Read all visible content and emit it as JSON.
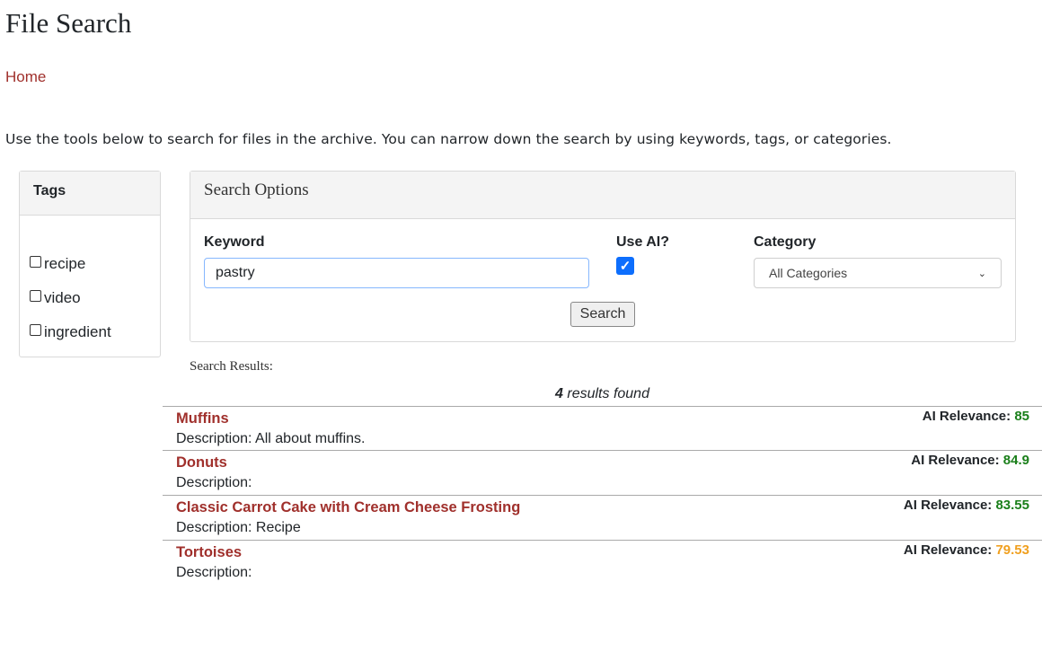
{
  "page": {
    "title": "File Search",
    "home_link": "Home",
    "intro": "Use the tools below to search for files in the archive. You can narrow down the search by using keywords, tags, or categories."
  },
  "tags": {
    "header": "Tags",
    "items": [
      {
        "label": "recipe",
        "checked": false
      },
      {
        "label": "video",
        "checked": false
      },
      {
        "label": "ingredient",
        "checked": false
      }
    ]
  },
  "search": {
    "header": "Search Options",
    "keyword_label": "Keyword",
    "keyword_value": "pastry",
    "use_ai_label": "Use AI?",
    "use_ai_checked": true,
    "category_label": "Category",
    "category_selected": "All Categories",
    "search_button": "Search"
  },
  "results": {
    "label": "Search Results:",
    "count": "4",
    "count_suffix": " results found",
    "relevance_label": "AI Relevance: ",
    "items": [
      {
        "title": "Muffins",
        "description": "Description: All about muffins.",
        "relevance": "85",
        "relevance_color": "#1a7f1a"
      },
      {
        "title": "Donuts",
        "description": "Description:",
        "relevance": "84.9",
        "relevance_color": "#1a7f1a"
      },
      {
        "title": "Classic Carrot Cake with Cream Cheese Frosting",
        "description": "Description: Recipe",
        "relevance": "83.55",
        "relevance_color": "#1a7f1a"
      },
      {
        "title": "Tortoises",
        "description": "Description:",
        "relevance": "79.53",
        "relevance_color": "#f0a020"
      }
    ]
  },
  "colors": {
    "link": "#a0302c",
    "checkbox_accent": "#0d6efd"
  }
}
